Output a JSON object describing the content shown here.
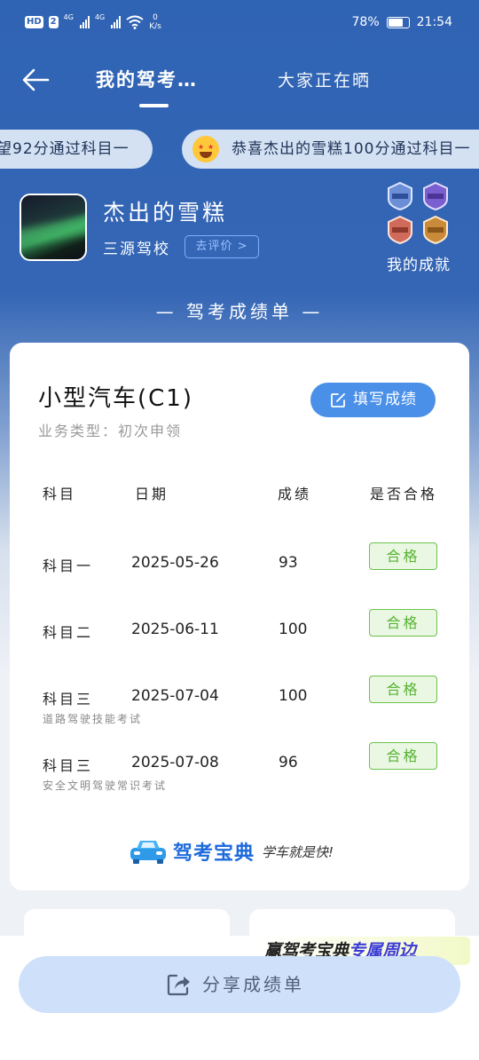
{
  "status_bar": {
    "hd": "HD",
    "sim": "2",
    "net1": "4G",
    "net2": "4G",
    "speed_value": "0",
    "speed_unit": "K/s",
    "battery": "78%",
    "time": "21:54"
  },
  "nav": {
    "tab_active": "我的驾考…",
    "tab_other": "大家正在晒"
  },
  "ticker": {
    "item1": "望92分通过科目一",
    "item2": "恭喜杰出的雪糕100分通过科目一"
  },
  "profile": {
    "username": "杰出的雪糕",
    "school": "三源驾校",
    "rate_button": "去评价 >",
    "achievements_label": "我的成就"
  },
  "section_title": "— 驾考成绩单 —",
  "card": {
    "vehicle": "小型汽车(C1)",
    "business_type": "业务类型：初次申领",
    "fill_button": "填写成绩",
    "headers": [
      "科目",
      "日期",
      "成绩",
      "是否合格"
    ],
    "rows": [
      {
        "subject": "科目一",
        "date": "2025-05-26",
        "score": "93",
        "result": "合格",
        "note": ""
      },
      {
        "subject": "科目二",
        "date": "2025-06-11",
        "score": "100",
        "result": "合格",
        "note": ""
      },
      {
        "subject": "科目三",
        "date": "2025-07-04",
        "score": "100",
        "result": "合格",
        "note": "道路驾驶技能考试"
      },
      {
        "subject": "科目三",
        "date": "2025-07-08",
        "score": "96",
        "result": "合格",
        "note": "安全文明驾驶常识考试"
      }
    ],
    "brand_name": "驾考宝典",
    "brand_slogan": "学车就是快!"
  },
  "promo": {
    "part1": "赢驾考宝典",
    "part2": "专属周边"
  },
  "share_button": "分享成绩单",
  "colors": {
    "primary": "#2f63b4",
    "accent": "#4a90e8",
    "pass": "#56b332"
  }
}
